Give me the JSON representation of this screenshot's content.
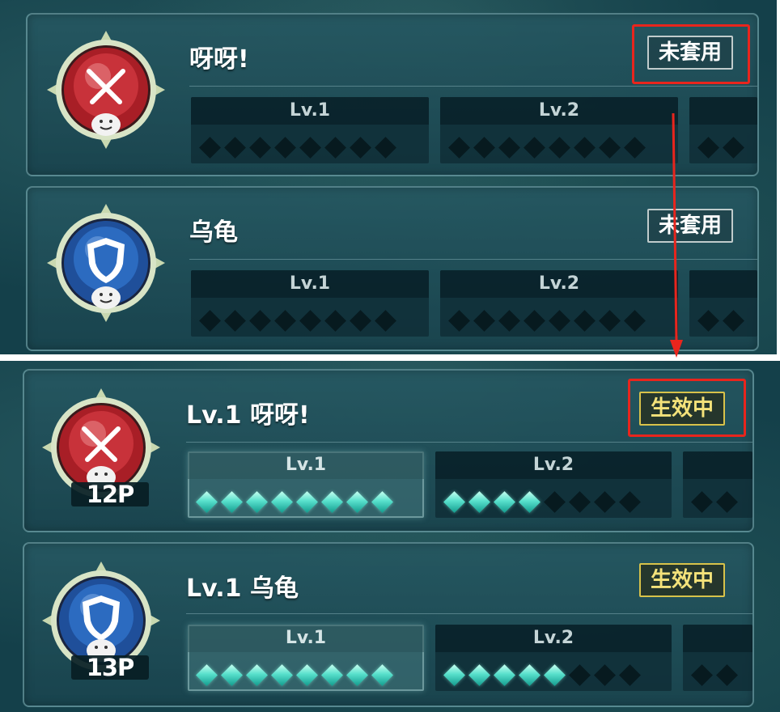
{
  "colors": {
    "annotation_red": "#e8251d",
    "active_gold": "#d8c24a",
    "gem_cyan": "#58e0cc",
    "background_teal": "#14404a"
  },
  "panels": [
    {
      "id": "before",
      "cards": [
        {
          "badge_icon": "crossed-swords-icon",
          "badge_color": "red",
          "title": "呀呀!",
          "status": "未套用",
          "status_active": false,
          "highlighted": true,
          "levels": [
            {
              "label": "Lv.1",
              "gems_filled": 0,
              "gems_total": 8
            },
            {
              "label": "Lv.2",
              "gems_filled": 0,
              "gems_total": 8
            }
          ]
        },
        {
          "badge_icon": "shield-icon",
          "badge_color": "blue",
          "title": "乌龟",
          "status": "未套用",
          "status_active": false,
          "highlighted": false,
          "levels": [
            {
              "label": "Lv.1",
              "gems_filled": 0,
              "gems_total": 8
            },
            {
              "label": "Lv.2",
              "gems_filled": 0,
              "gems_total": 8
            }
          ]
        }
      ]
    },
    {
      "id": "after",
      "cards": [
        {
          "badge_icon": "crossed-swords-icon",
          "badge_color": "red",
          "points": "12P",
          "title": "Lv.1 呀呀!",
          "status": "生效中",
          "status_active": true,
          "highlighted": true,
          "levels": [
            {
              "label": "Lv.1",
              "gems_filled": 8,
              "gems_total": 8,
              "current": true
            },
            {
              "label": "Lv.2",
              "gems_filled": 4,
              "gems_total": 8
            }
          ]
        },
        {
          "badge_icon": "shield-icon",
          "badge_color": "blue",
          "points": "13P",
          "title": "Lv.1 乌龟",
          "status": "生效中",
          "status_active": true,
          "highlighted": false,
          "levels": [
            {
              "label": "Lv.1",
              "gems_filled": 8,
              "gems_total": 8,
              "current": true
            },
            {
              "label": "Lv.2",
              "gems_filled": 5,
              "gems_total": 8
            }
          ]
        }
      ]
    }
  ]
}
